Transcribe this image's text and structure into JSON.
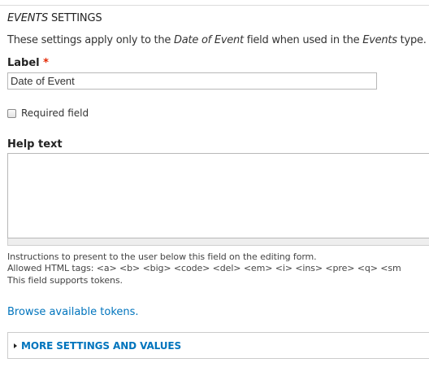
{
  "section": {
    "title_italic": "EVENTS",
    "title_rest": " SETTINGS"
  },
  "intro": {
    "part1": "These settings apply only to the ",
    "field_name": "Date of Event",
    "part2": " field when used in the ",
    "type_name": "Events",
    "part3": " type."
  },
  "label_field": {
    "label": "Label",
    "required_mark": "*",
    "value": "Date of Event"
  },
  "required_checkbox": {
    "label": "Required field",
    "checked": false
  },
  "help_text": {
    "label": "Help text",
    "value": "",
    "description_line1": "Instructions to present to the user below this field on the editing form.",
    "description_line2": "Allowed HTML tags: <a> <b> <big> <code> <del> <em> <i> <ins> <pre> <q> <sm",
    "description_line3": "This field supports tokens."
  },
  "tokens_link": {
    "text": "Browse available tokens."
  },
  "more_settings": {
    "label": "MORE SETTINGS AND VALUES"
  },
  "colors": {
    "link": "#0074bd",
    "required": "#e32700"
  }
}
